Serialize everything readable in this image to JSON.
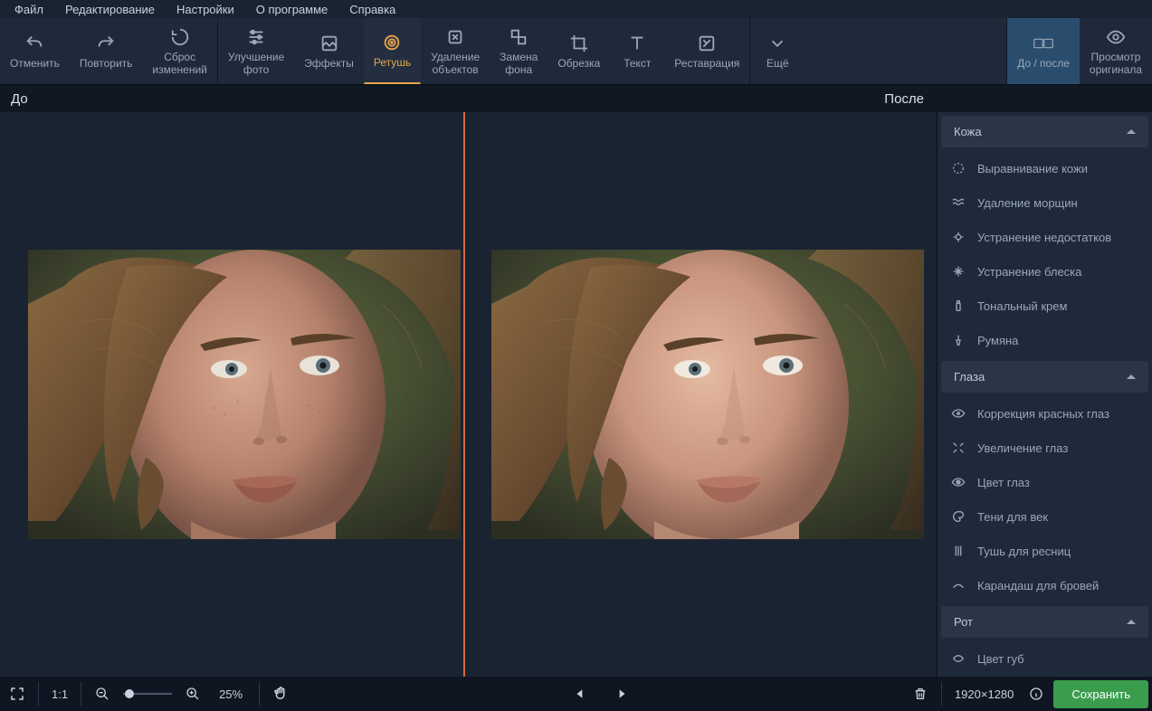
{
  "menu": [
    "Файл",
    "Редактирование",
    "Настройки",
    "О программе",
    "Справка"
  ],
  "toolbar": {
    "undo": "Отменить",
    "redo": "Повторить",
    "reset": "Сброс\nизменений",
    "enhance": "Улучшение\nфото",
    "effects": "Эффекты",
    "retouch": "Ретушь",
    "remove_objects": "Удаление\nобъектов",
    "replace_bg": "Замена\nфона",
    "crop": "Обрезка",
    "text": "Текст",
    "restoration": "Реставрация",
    "more": "Ещё",
    "before_after": "До / после",
    "view_original": "Просмотр\nоригинала"
  },
  "before_after": {
    "before": "До",
    "after": "После"
  },
  "panel": {
    "skin": {
      "title": "Кожа",
      "items": [
        "Выравнивание кожи",
        "Удаление морщин",
        "Устранение недостатков",
        "Устранение блеска",
        "Тональный крем",
        "Румяна"
      ]
    },
    "eyes": {
      "title": "Глаза",
      "items": [
        "Коррекция красных глаз",
        "Увеличение глаз",
        "Цвет глаз",
        "Тени для век",
        "Тушь для ресниц",
        "Карандаш для бровей"
      ]
    },
    "mouth": {
      "title": "Рот",
      "items": [
        "Цвет губ"
      ]
    }
  },
  "bottom": {
    "zoom_label": "25%",
    "one_to_one": "1:1",
    "dimensions": "1920×1280",
    "save": "Сохранить"
  }
}
